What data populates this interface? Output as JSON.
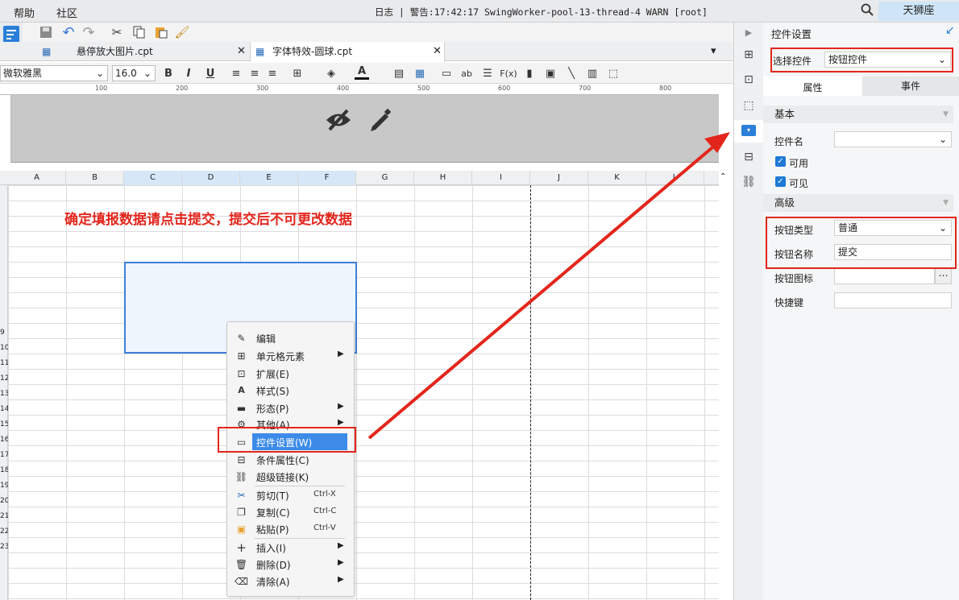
{
  "menubar": {
    "help": "帮助",
    "community": "社区",
    "log_text": "日志 | 警告:17:42:17 SwingWorker-pool-13-thread-4 WARN [root]",
    "user": "天狮座"
  },
  "tabs": [
    {
      "label": "悬停放大图片.cpt"
    },
    {
      "label": "字体特效-圆球.cpt"
    }
  ],
  "format_toolbar": {
    "font_family": "微软雅黑",
    "font_size": "16.0"
  },
  "ruler": {
    "ticks": [
      "100",
      "200",
      "300",
      "400",
      "500",
      "600",
      "700",
      "800"
    ]
  },
  "columns": [
    "A",
    "B",
    "C",
    "D",
    "E",
    "F",
    "G",
    "H",
    "I",
    "J",
    "K",
    "L"
  ],
  "rows": [
    "9",
    "10",
    "11",
    "12",
    "13",
    "14",
    "15",
    "16",
    "17",
    "18",
    "19",
    "20",
    "21",
    "22",
    "23"
  ],
  "sheet": {
    "notice": "确定填报数据请点击提交，提交后不可更改数据"
  },
  "context_menu": {
    "items": [
      {
        "label": "编辑",
        "icon": "pencil-icon",
        "shortcut": "",
        "submenu": false
      },
      {
        "label": "单元格元素",
        "icon": "cell-element-icon",
        "shortcut": "",
        "submenu": true
      },
      {
        "label": "扩展(E)",
        "icon": "expand-icon",
        "shortcut": "",
        "submenu": false
      },
      {
        "label": "样式(S)",
        "icon": "style-icon",
        "shortcut": "",
        "submenu": false
      },
      {
        "label": "形态(P)",
        "icon": "form-icon",
        "shortcut": "",
        "submenu": true
      },
      {
        "label": "其他(A)",
        "icon": "gear-icon",
        "shortcut": "",
        "submenu": true
      },
      {
        "label": "控件设置(W)",
        "icon": "widget-icon",
        "shortcut": "",
        "submenu": false
      },
      {
        "label": "条件属性(C)",
        "icon": "condition-icon",
        "shortcut": "",
        "submenu": false
      },
      {
        "label": "超级链接(K)",
        "icon": "link-icon",
        "shortcut": "",
        "submenu": false
      },
      {
        "label": "剪切(T)",
        "icon": "scissors-icon",
        "shortcut": "Ctrl-X",
        "submenu": false
      },
      {
        "label": "复制(C)",
        "icon": "copy-icon",
        "shortcut": "Ctrl-C",
        "submenu": false
      },
      {
        "label": "粘贴(P)",
        "icon": "paste-icon",
        "shortcut": "Ctrl-V",
        "submenu": false
      },
      {
        "label": "插入(I)",
        "icon": "plus-icon",
        "shortcut": "",
        "submenu": true
      },
      {
        "label": "删除(D)",
        "icon": "trash-icon",
        "shortcut": "",
        "submenu": true
      },
      {
        "label": "清除(A)",
        "icon": "clear-icon",
        "shortcut": "",
        "submenu": true
      }
    ]
  },
  "right_panel": {
    "title": "控件设置",
    "select_widget_label": "选择控件",
    "select_widget_value": "按钮控件",
    "tab_properties": "属性",
    "tab_events": "事件",
    "section_basic": "基本",
    "widget_name_label": "控件名",
    "widget_name_value": "",
    "enabled_label": "可用",
    "visible_label": "可见",
    "section_advanced": "高级",
    "button_type_label": "按钮类型",
    "button_type_value": "普通",
    "button_name_label": "按钮名称",
    "button_name_value": "提交",
    "button_icon_label": "按钮图标",
    "shortcut_label": "快捷键"
  },
  "colors": {
    "accent": "#3d8be8",
    "annotation": "#e3261c",
    "selection": "#3d7fd9"
  }
}
